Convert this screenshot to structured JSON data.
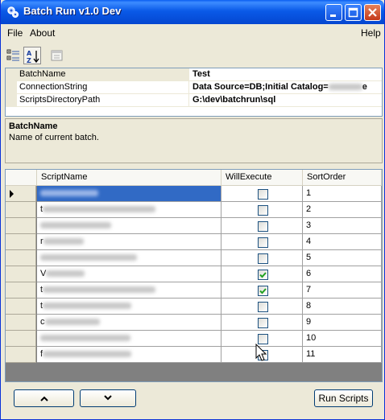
{
  "window": {
    "title": "Batch Run v1.0 Dev",
    "icons": {
      "app": "gear-app-icon",
      "minimize": "minimize-icon",
      "maximize": "maximize-icon",
      "close": "close-icon"
    }
  },
  "menu": {
    "file": "File",
    "about": "About",
    "help": "Help"
  },
  "toolbar": {
    "buttons": [
      "categorized-view-icon",
      "alphabetical-sort-icon",
      "property-pages-icon"
    ],
    "alpha_a": "A",
    "alpha_z": "Z"
  },
  "properties": [
    {
      "name": "BatchName",
      "value": "Test"
    },
    {
      "name": "ConnectionString",
      "value": "Data Source=DB;Initial Catalog=",
      "value_suffix": "e"
    },
    {
      "name": "ScriptsDirectoryPath",
      "value": "G:\\dev\\batchrun\\sql"
    }
  ],
  "description": {
    "title": "BatchName",
    "text": "Name of current batch."
  },
  "grid": {
    "columns": [
      "ScriptName",
      "WillExecute",
      "SortOrder"
    ],
    "rows": [
      {
        "name_prefix": "",
        "will_execute": false,
        "sort_order": "1"
      },
      {
        "name_prefix": "t",
        "will_execute": false,
        "sort_order": "2"
      },
      {
        "name_prefix": "",
        "will_execute": false,
        "sort_order": "3"
      },
      {
        "name_prefix": "r",
        "will_execute": false,
        "sort_order": "4"
      },
      {
        "name_prefix": "",
        "will_execute": false,
        "sort_order": "5"
      },
      {
        "name_prefix": "V",
        "will_execute": true,
        "sort_order": "6"
      },
      {
        "name_prefix": "t",
        "will_execute": true,
        "sort_order": "7"
      },
      {
        "name_prefix": "t",
        "will_execute": false,
        "sort_order": "8"
      },
      {
        "name_prefix": "c",
        "will_execute": false,
        "sort_order": "9"
      },
      {
        "name_prefix": "",
        "will_execute": false,
        "sort_order": "10"
      },
      {
        "name_prefix": "f",
        "will_execute": false,
        "sort_order": "11"
      }
    ]
  },
  "buttons": {
    "move_up_icon": "chevron-up-icon",
    "move_down_icon": "chevron-down-icon",
    "run_scripts": "Run Scripts"
  },
  "colors": {
    "titlebar": "#0a5ae8",
    "selection": "#316ac5",
    "check": "#21a121"
  }
}
